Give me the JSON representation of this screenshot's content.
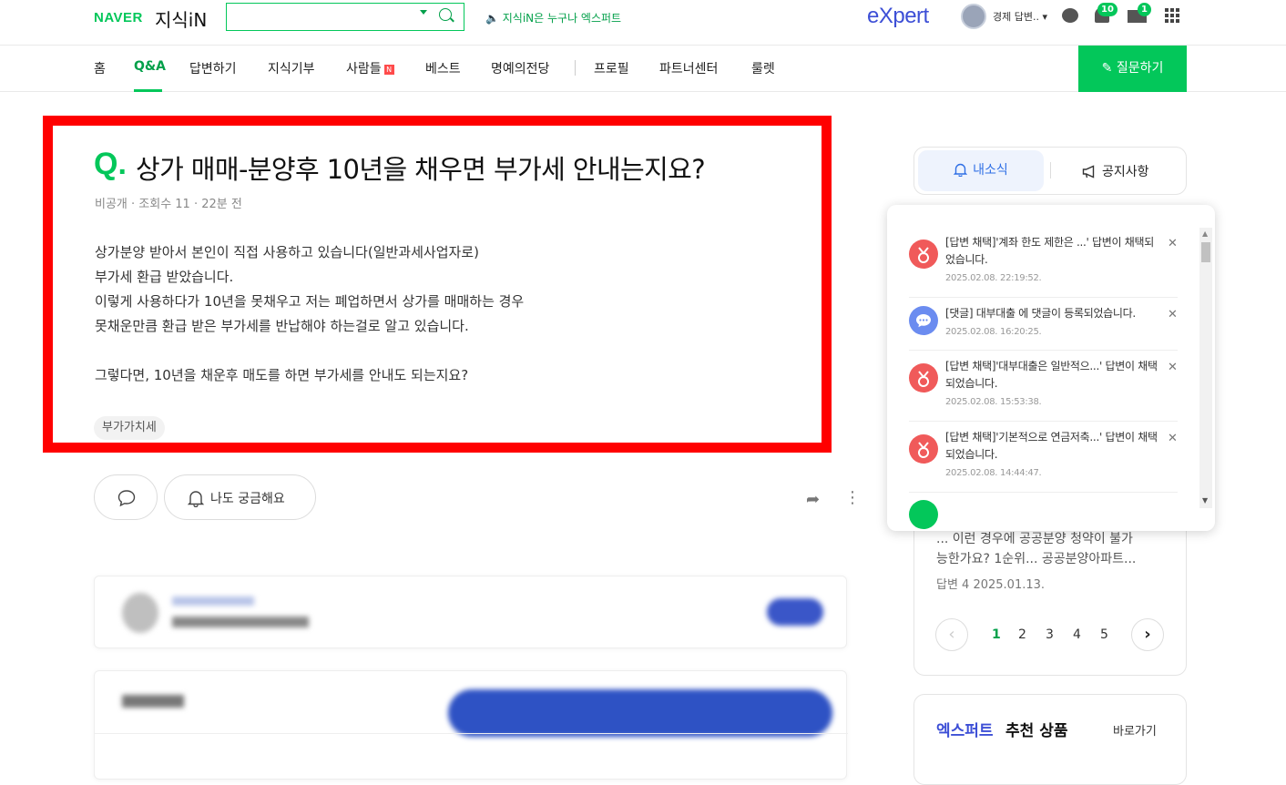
{
  "header": {
    "logo_naver": "NAVER",
    "logo_kin": "지식iN",
    "search_placeholder": "",
    "promo": "🔈 지식iN은 누구나 엑스퍼트",
    "expert_logo": "eXpert",
    "user_name": "경제 답변..",
    "notification_count": "10",
    "mail_count": "1"
  },
  "nav": {
    "items": [
      "홈",
      "Q&A",
      "답변하기",
      "지식기부",
      "사람들",
      "베스트",
      "명예의전당",
      "프로필",
      "파트너센터",
      "룰렛"
    ],
    "new_badge": "N",
    "ask_button": "✎ 질문하기"
  },
  "question": {
    "q_mark": "Q.",
    "title": "상가 매매-분양후 10년을 채우면 부가세 안내는지요?",
    "meta": "비공개 · 조회수 11 · 22분 전",
    "body": [
      "상가분양 받아서 본인이 직접 사용하고 있습니다(일반과세사업자로)",
      "부가세 환급 받았습니다.",
      "이렇게 사용하다가 10년을 못채우고 저는 폐업하면서 상가를 매매하는 경우",
      "못채운만큼 환급 받은 부가세를 반납해야 하는걸로 알고 있습니다.",
      "",
      "그렇다면, 10년을 채운후 매도를 하면 부가세를 안내도 되는지요?"
    ],
    "tag": "부가가치세",
    "curious_button": "나도 궁금해요"
  },
  "sidebar": {
    "tab_news": "내소식",
    "tab_notice": "공지사항",
    "related_snippet_1": "... 이런 경우에 공공분양 청약이 불가",
    "related_snippet_2": "능한가요? 1순위... 공공분양아파트...",
    "related_meta": "답변 4  2025.01.13.",
    "pages": [
      "1",
      "2",
      "3",
      "4",
      "5"
    ],
    "expert_title_a": "엑스퍼트",
    "expert_title_b": "추천 상품",
    "expert_link": "바로가기"
  },
  "notifications": [
    {
      "type": "adopt",
      "text": "[답변 채택]'계좌 한도 제한은 ...' 답변이 채택되었습니다.",
      "date": "2025.02.08. 22:19:52."
    },
    {
      "type": "comment",
      "text": "[댓글] 대부대출 에 댓글이 등록되었습니다.",
      "date": "2025.02.08. 16:20:25."
    },
    {
      "type": "adopt",
      "text": "[답변 채택]'대부대출은 일반적으...' 답변이 채택되었습니다.",
      "date": "2025.02.08. 15:53:38."
    },
    {
      "type": "adopt",
      "text": "[답변 채택]'기본적으로 연금저축...' 답변이 채택되었습니다.",
      "date": "2025.02.08. 14:44:47."
    }
  ],
  "colors": {
    "brand_green": "#03c75a",
    "highlight_red": "#ff0000",
    "expert_blue": "#3d4fd6",
    "adopt_icon": "#f05a5a",
    "comment_icon": "#6b8cf0"
  }
}
